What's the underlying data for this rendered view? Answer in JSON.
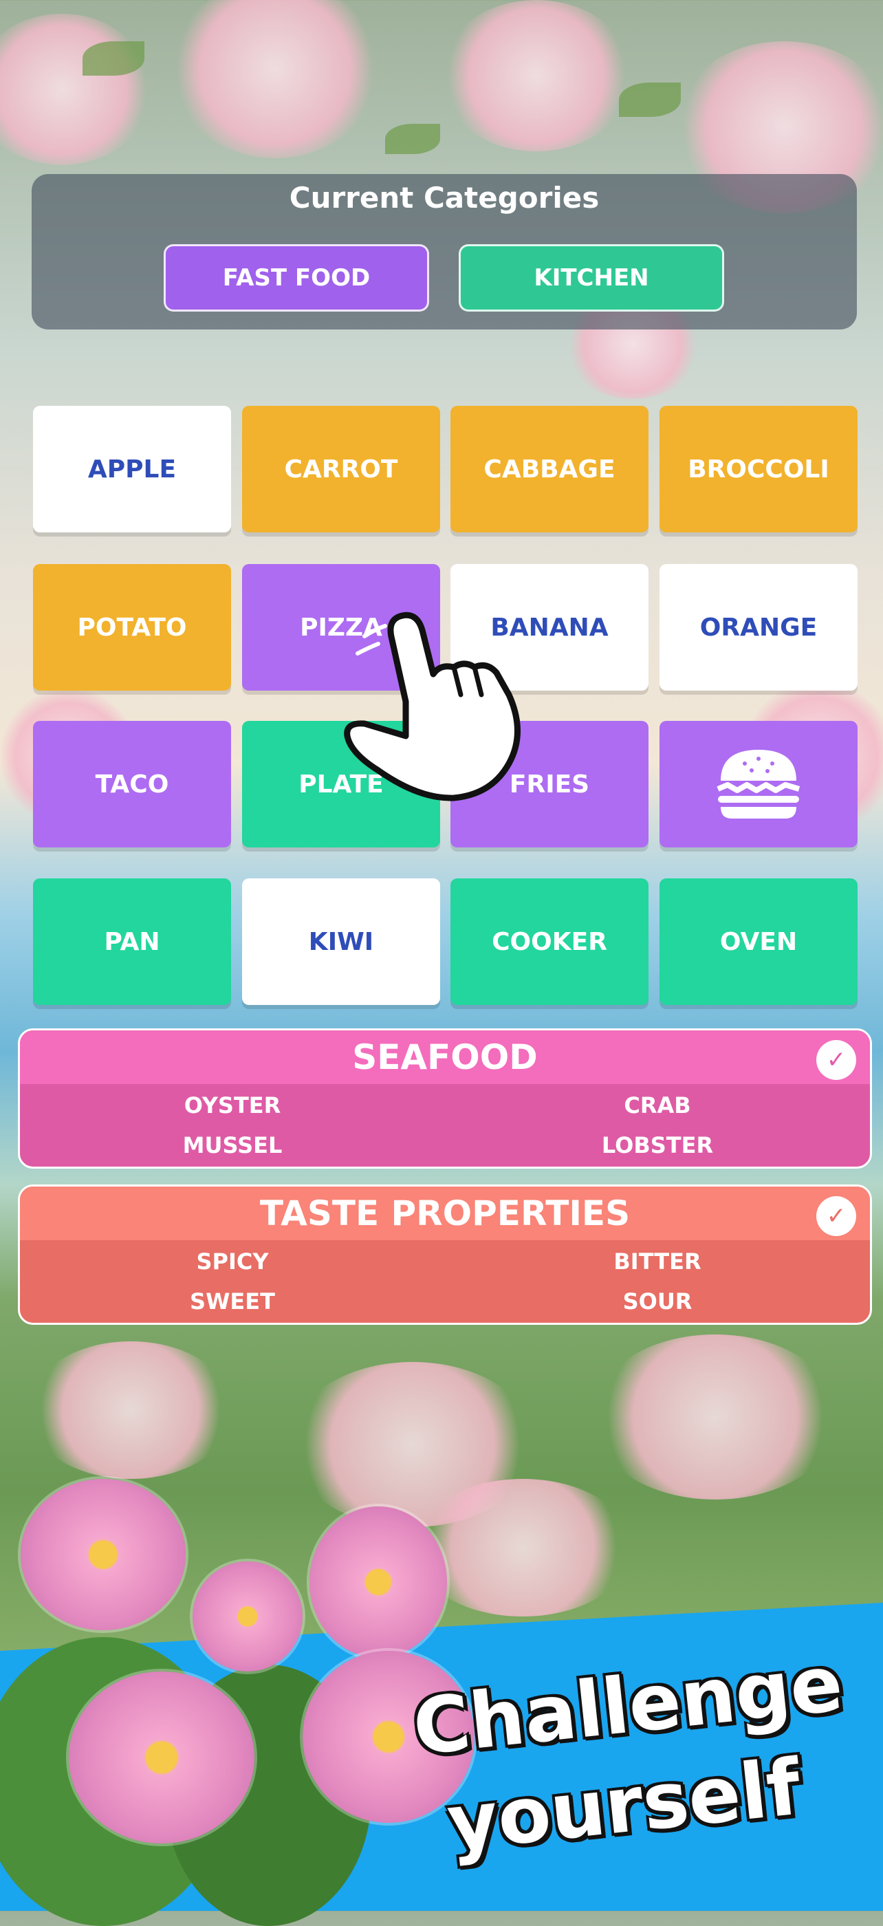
{
  "current_categories": {
    "title": "Current Categories",
    "pills": [
      "FAST FOOD",
      "KITCHEN"
    ]
  },
  "grid": [
    [
      {
        "label": "APPLE",
        "style": "white"
      },
      {
        "label": "CARROT",
        "style": "orange"
      },
      {
        "label": "CABBAGE",
        "style": "orange"
      },
      {
        "label": "BROCCOLI",
        "style": "orange"
      }
    ],
    [
      {
        "label": "POTATO",
        "style": "orange"
      },
      {
        "label": "PIZZA",
        "style": "purple"
      },
      {
        "label": "BANANA",
        "style": "white"
      },
      {
        "label": "ORANGE",
        "style": "white"
      }
    ],
    [
      {
        "label": "TACO",
        "style": "purple"
      },
      {
        "label": "PLATE",
        "style": "green"
      },
      {
        "label": "FRIES",
        "style": "purple"
      },
      {
        "label": "",
        "style": "purple",
        "icon": "burger-icon"
      }
    ],
    [
      {
        "label": "PAN",
        "style": "green"
      },
      {
        "label": "KIWI",
        "style": "white"
      },
      {
        "label": "COOKER",
        "style": "green"
      },
      {
        "label": "OVEN",
        "style": "green"
      }
    ]
  ],
  "solved_groups": [
    {
      "title": "SEAFOOD",
      "color": "#df5aa5",
      "words": [
        "OYSTER",
        "CRAB",
        "MUSSEL",
        "LOBSTER"
      ]
    },
    {
      "title": "TASTE PROPERTIES",
      "color": "#e86d64",
      "words": [
        "SPICY",
        "BITTER",
        "SWEET",
        "SOUR"
      ]
    }
  ],
  "banner": {
    "line1": "Challenge",
    "line2": "yourself"
  },
  "colors": {
    "white_tile_text": "#2f4db8",
    "orange": "#f2b22d",
    "purple": "#ad6cf2",
    "green": "#22d69d",
    "banner": "#1aa5ef"
  }
}
